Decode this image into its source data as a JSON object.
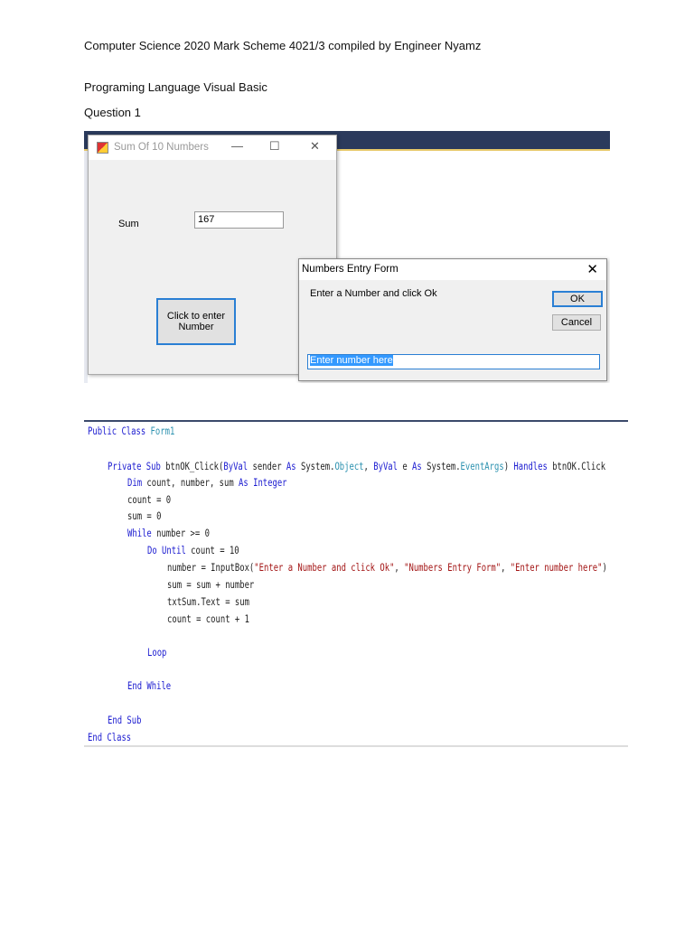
{
  "header": "Computer Science 2020 Mark Scheme 4021/3 compiled by Engineer Nyamz",
  "language_line": "Programing Language Visual Basic",
  "question": "Question 1",
  "form": {
    "title": "Sum Of 10 Numbers",
    "minimize": "—",
    "maximize": "☐",
    "close": "✕",
    "sum_label": "Sum",
    "sum_value": "167",
    "enter_button": "Click to enter Number"
  },
  "dialog": {
    "title": "Numbers Entry Form",
    "close": "✕",
    "prompt": "Enter a Number and click Ok",
    "ok": "OK",
    "cancel": "Cancel",
    "input_value": "Enter number here"
  },
  "code": [
    [
      [
        "Public Class ",
        "k"
      ],
      [
        "Form1",
        "t"
      ]
    ],
    [
      [
        "Private Sub ",
        "k"
      ],
      [
        "btnOK_Click(",
        "p"
      ],
      [
        "ByVal ",
        "k"
      ],
      [
        "sender ",
        "p"
      ],
      [
        "As ",
        "k"
      ],
      [
        "System.",
        "p"
      ],
      [
        "Object",
        "t"
      ],
      [
        ", ",
        "p"
      ],
      [
        "ByVal ",
        "k"
      ],
      [
        "e ",
        "p"
      ],
      [
        "As ",
        "k"
      ],
      [
        "System.",
        "p"
      ],
      [
        "EventArgs",
        "t"
      ],
      [
        ") ",
        "p"
      ],
      [
        "Handles ",
        "k"
      ],
      [
        "btnOK.Click",
        "p"
      ]
    ],
    [
      [
        "Dim ",
        "k"
      ],
      [
        "count, number, sum ",
        "p"
      ],
      [
        "As Integer",
        "k"
      ]
    ],
    [
      [
        "count = 0",
        "p"
      ]
    ],
    [
      [
        "sum = 0",
        "p"
      ]
    ],
    [
      [
        "While ",
        "k"
      ],
      [
        "number >= 0",
        "p"
      ]
    ],
    [
      [
        "Do Until ",
        "k"
      ],
      [
        "count = 10",
        "p"
      ]
    ],
    [
      [
        "number = InputBox(",
        "p"
      ],
      [
        "\"Enter a Number and click Ok\"",
        "s"
      ],
      [
        ", ",
        "p"
      ],
      [
        "\"Numbers Entry Form\"",
        "s"
      ],
      [
        ", ",
        "p"
      ],
      [
        "\"Enter number here\"",
        "s"
      ],
      [
        ")",
        "p"
      ]
    ],
    [
      [
        "sum = sum + number",
        "p"
      ]
    ],
    [
      [
        "txtSum.Text = sum",
        "p"
      ]
    ],
    [
      [
        "count = count + 1",
        "p"
      ]
    ],
    [
      [
        "Loop",
        "k"
      ]
    ],
    [
      [
        "End While",
        "k"
      ]
    ],
    [
      [
        "End Sub",
        "k"
      ]
    ],
    [
      [
        "End Class",
        "k"
      ]
    ]
  ]
}
